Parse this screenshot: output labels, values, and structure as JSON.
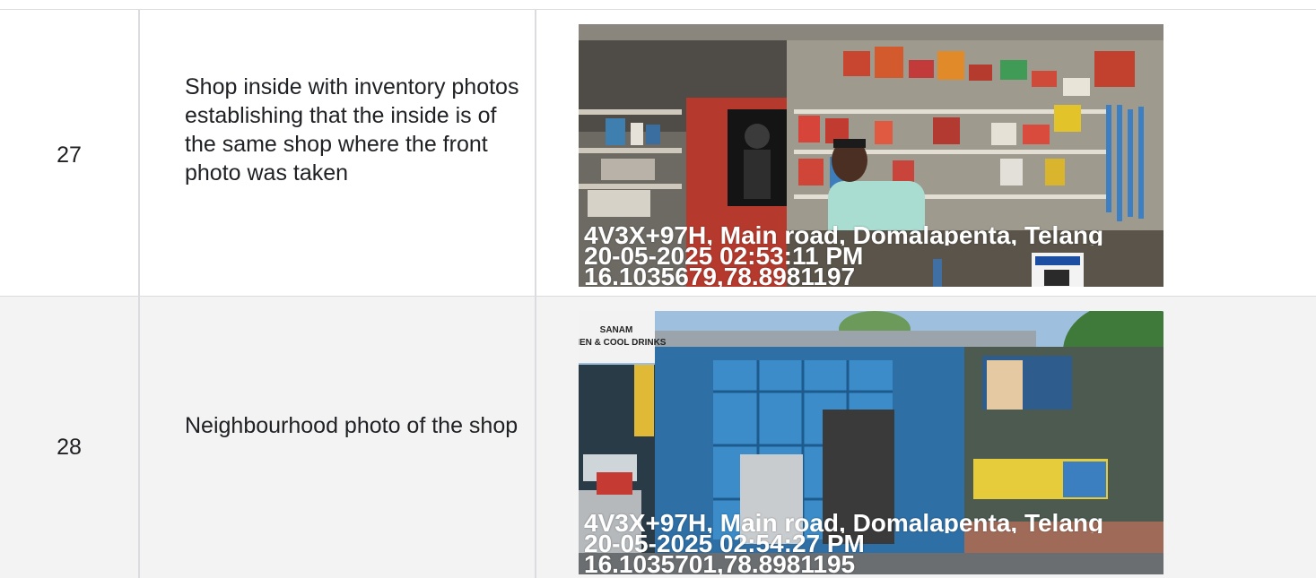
{
  "rows": [
    {
      "number": "27",
      "description": "Shop inside with inventory photos establishing that the inside is of the same shop where the front photo was taken",
      "photo": {
        "stamp_address": "4V3X+97H, Main road, Domalapenta, Telang",
        "stamp_datetime": "20-05-2025 02:53:11 PM",
        "stamp_coords": "16.1035679,78.8981197",
        "qr_brand": "paytm"
      }
    },
    {
      "number": "28",
      "description": "Neighbourhood photo of the shop",
      "photo": {
        "stamp_address": "4V3X+97H, Main road, Domalapenta, Telang",
        "stamp_datetime": "20-05-2025 02:54:27 PM",
        "stamp_coords": "16.1035701,78.8981195",
        "sign_line1": "SANAM",
        "sign_line2": "CHEN & COOL DRINKS"
      }
    }
  ],
  "colors": {
    "border": "#dadce0",
    "row_alt_bg": "#f3f3f3",
    "text": "#202124"
  }
}
